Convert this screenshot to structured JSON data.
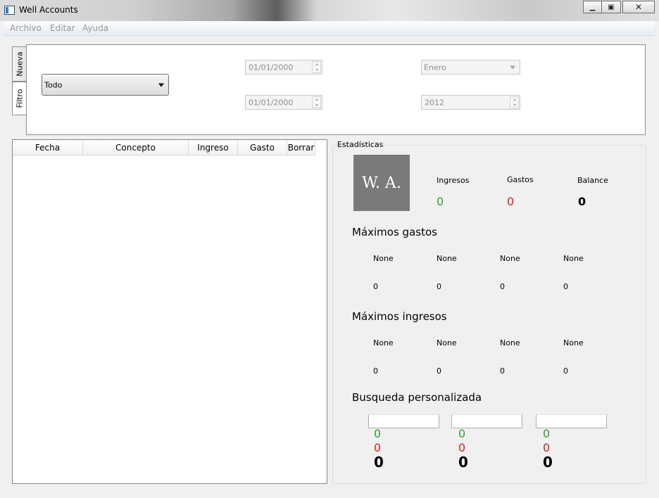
{
  "window": {
    "title": "Well Accounts"
  },
  "menu": [
    "Archivo",
    "Editar",
    "Ayuda"
  ],
  "tabs": {
    "nueva": "Nueva",
    "filtro": "Filtro"
  },
  "filter": {
    "mode": "Todo",
    "date_from": "01/01/2000",
    "date_to": "01/01/2000",
    "month": "Enero",
    "year": "2012"
  },
  "table": {
    "columns": [
      "Fecha",
      "Concepto",
      "Ingreso",
      "Gasto",
      "Borrar"
    ]
  },
  "stats": {
    "group_title": "Estadísticas",
    "logo_text": "W. A.",
    "summary": {
      "ingresos_label": "Ingresos",
      "ingresos_value": "0",
      "gastos_label": "Gastos",
      "gastos_value": "0",
      "balance_label": "Balance",
      "balance_value": "0"
    },
    "max_gastos": {
      "title": "Máximos gastos",
      "items": [
        {
          "name": "None",
          "value": "0"
        },
        {
          "name": "None",
          "value": "0"
        },
        {
          "name": "None",
          "value": "0"
        },
        {
          "name": "None",
          "value": "0"
        }
      ]
    },
    "max_ingresos": {
      "title": "Máximos ingresos",
      "items": [
        {
          "name": "None",
          "value": "0"
        },
        {
          "name": "None",
          "value": "0"
        },
        {
          "name": "None",
          "value": "0"
        },
        {
          "name": "None",
          "value": "0"
        }
      ]
    },
    "custom_search": {
      "title": "Busqueda personalizada",
      "columns": [
        {
          "query": "",
          "ingreso": "0",
          "gasto": "0",
          "balance": "0"
        },
        {
          "query": "",
          "ingreso": "0",
          "gasto": "0",
          "balance": "0"
        },
        {
          "query": "",
          "ingreso": "0",
          "gasto": "0",
          "balance": "0"
        }
      ]
    }
  },
  "colors": {
    "ingreso": "#2fa12f",
    "gasto": "#d42020",
    "logo_bg": "#7a7a7a"
  },
  "icons": [
    "app-icon",
    "minimize-icon",
    "maximize-icon",
    "close-icon",
    "dropdown-arrow-icon",
    "spin-up-icon",
    "spin-down-icon"
  ]
}
